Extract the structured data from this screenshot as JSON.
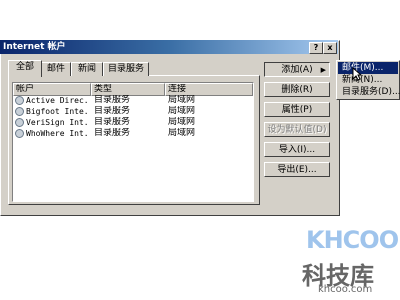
{
  "dialog": {
    "title": "Internet 帐户",
    "help_label": "?",
    "close_label": "x"
  },
  "tabs": [
    "全部",
    "邮件",
    "新闻",
    "目录服务"
  ],
  "list": {
    "columns": [
      "帐户",
      "类型",
      "连接"
    ],
    "rows": [
      {
        "account": "Active Direc...",
        "type": "目录服务",
        "connection": "局域网"
      },
      {
        "account": "Bigfoot Inte...",
        "type": "目录服务",
        "connection": "局域网"
      },
      {
        "account": "VeriSign Int...",
        "type": "目录服务",
        "connection": "局域网"
      },
      {
        "account": "WhoWhere Int...",
        "type": "目录服务",
        "connection": "局域网"
      }
    ]
  },
  "buttons": {
    "add": "添加(A)",
    "add_arrow": "▶",
    "remove": "删除(R)",
    "properties": "属性(P)",
    "set_default": "设为默认值(D)",
    "import": "导入(I)...",
    "export": "导出(E)..."
  },
  "add_menu": [
    "邮件(M)...",
    "新闻(N)...",
    "目录服务(D)..."
  ],
  "watermark": {
    "logo": "KHCOO",
    "title": "科技库",
    "url": "khcoo.com"
  }
}
